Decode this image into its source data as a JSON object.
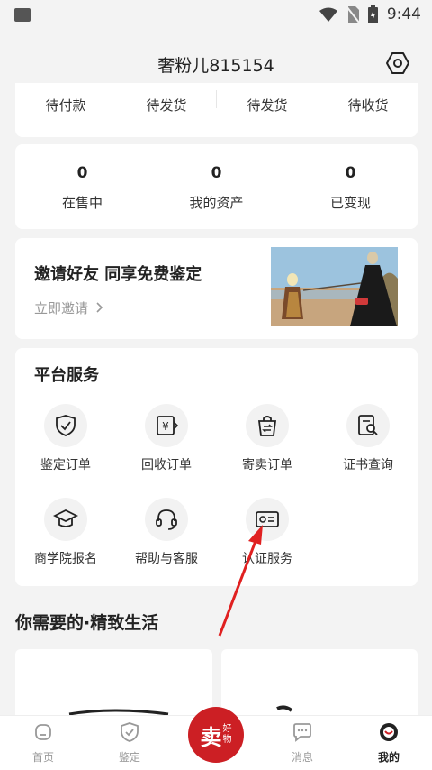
{
  "status_bar": {
    "time": "9:44"
  },
  "header": {
    "title": "奢粉儿815154"
  },
  "orders": {
    "items": [
      "待付款",
      "待发货",
      "待发货",
      "待收货"
    ]
  },
  "stats": [
    {
      "value": "0",
      "label": "在售中"
    },
    {
      "value": "0",
      "label": "我的资产"
    },
    {
      "value": "0",
      "label": "已变现"
    }
  ],
  "invite": {
    "title": "邀请好友 同享免费鉴定",
    "link": "立即邀请"
  },
  "services": {
    "title": "平台服务",
    "items": [
      {
        "label": "鉴定订单",
        "icon": "shield-check-icon"
      },
      {
        "label": "回收订单",
        "icon": "yen-receipt-icon"
      },
      {
        "label": "寄卖订单",
        "icon": "bag-exchange-icon"
      },
      {
        "label": "证书查询",
        "icon": "certificate-search-icon"
      },
      {
        "label": "商学院报名",
        "icon": "graduation-cap-icon"
      },
      {
        "label": "帮助与客服",
        "icon": "headset-icon"
      },
      {
        "label": "认证服务",
        "icon": "id-card-icon"
      }
    ]
  },
  "section": {
    "title": "你需要的·精致生活"
  },
  "tabbar": {
    "items": [
      {
        "label": "首页",
        "icon": "home-icon"
      },
      {
        "label": "鉴定",
        "icon": "shield-icon"
      },
      {
        "label": "消息",
        "icon": "chat-icon"
      },
      {
        "label": "我的",
        "icon": "profile-icon"
      }
    ],
    "sell": {
      "main": "卖",
      "sub1": "好",
      "sub2": "物"
    }
  },
  "colors": {
    "accent": "#cc1f24",
    "background": "#f3f3f3"
  }
}
